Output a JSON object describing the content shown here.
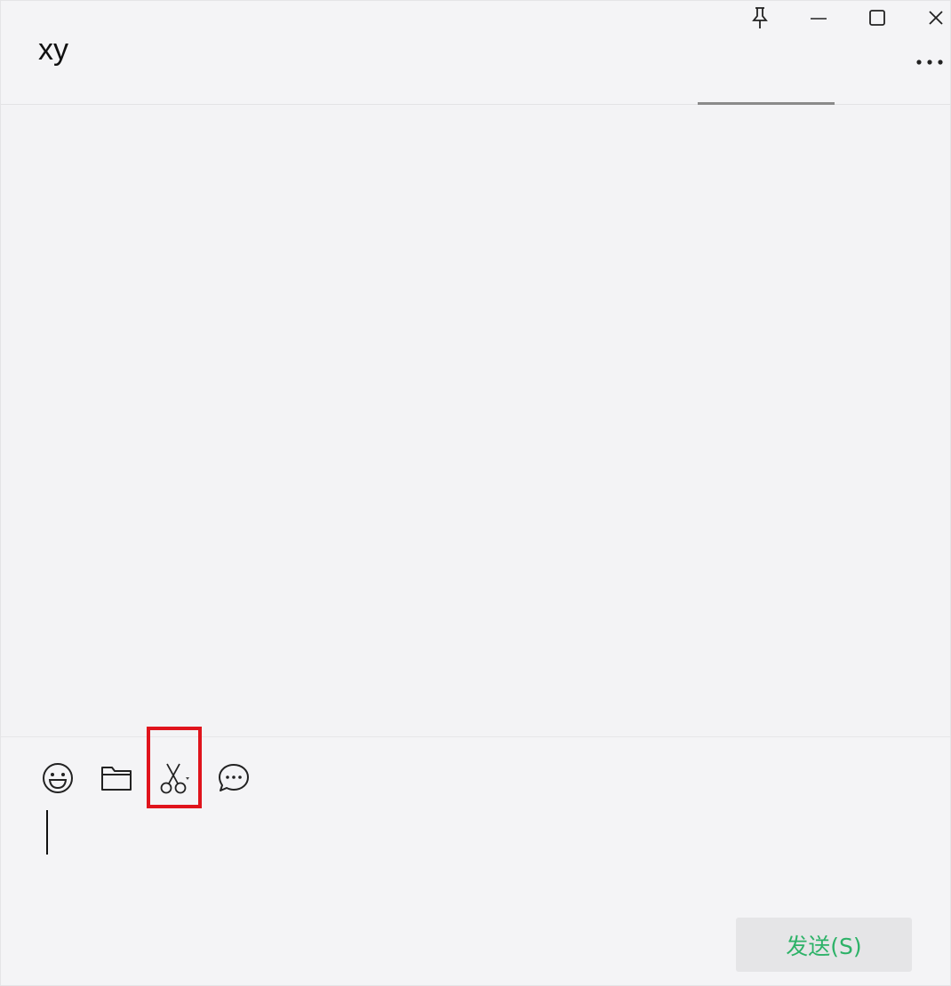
{
  "window": {
    "title": "xy"
  },
  "title_bar": {
    "controls": [
      {
        "name": "pin-icon"
      },
      {
        "name": "minimize-icon"
      },
      {
        "name": "maximize-icon"
      },
      {
        "name": "close-icon"
      }
    ],
    "more_icon": "more-icon"
  },
  "toolbar": {
    "items": [
      {
        "name": "emoji-icon"
      },
      {
        "name": "folder-icon"
      },
      {
        "name": "scissors-icon",
        "highlighted": true
      },
      {
        "name": "chat-history-icon"
      }
    ]
  },
  "composer": {
    "value": ""
  },
  "send": {
    "label": "发送(S)"
  },
  "colors": {
    "send_text": "#2db268",
    "highlight": "#e0141c",
    "background": "#f4f4f6"
  }
}
